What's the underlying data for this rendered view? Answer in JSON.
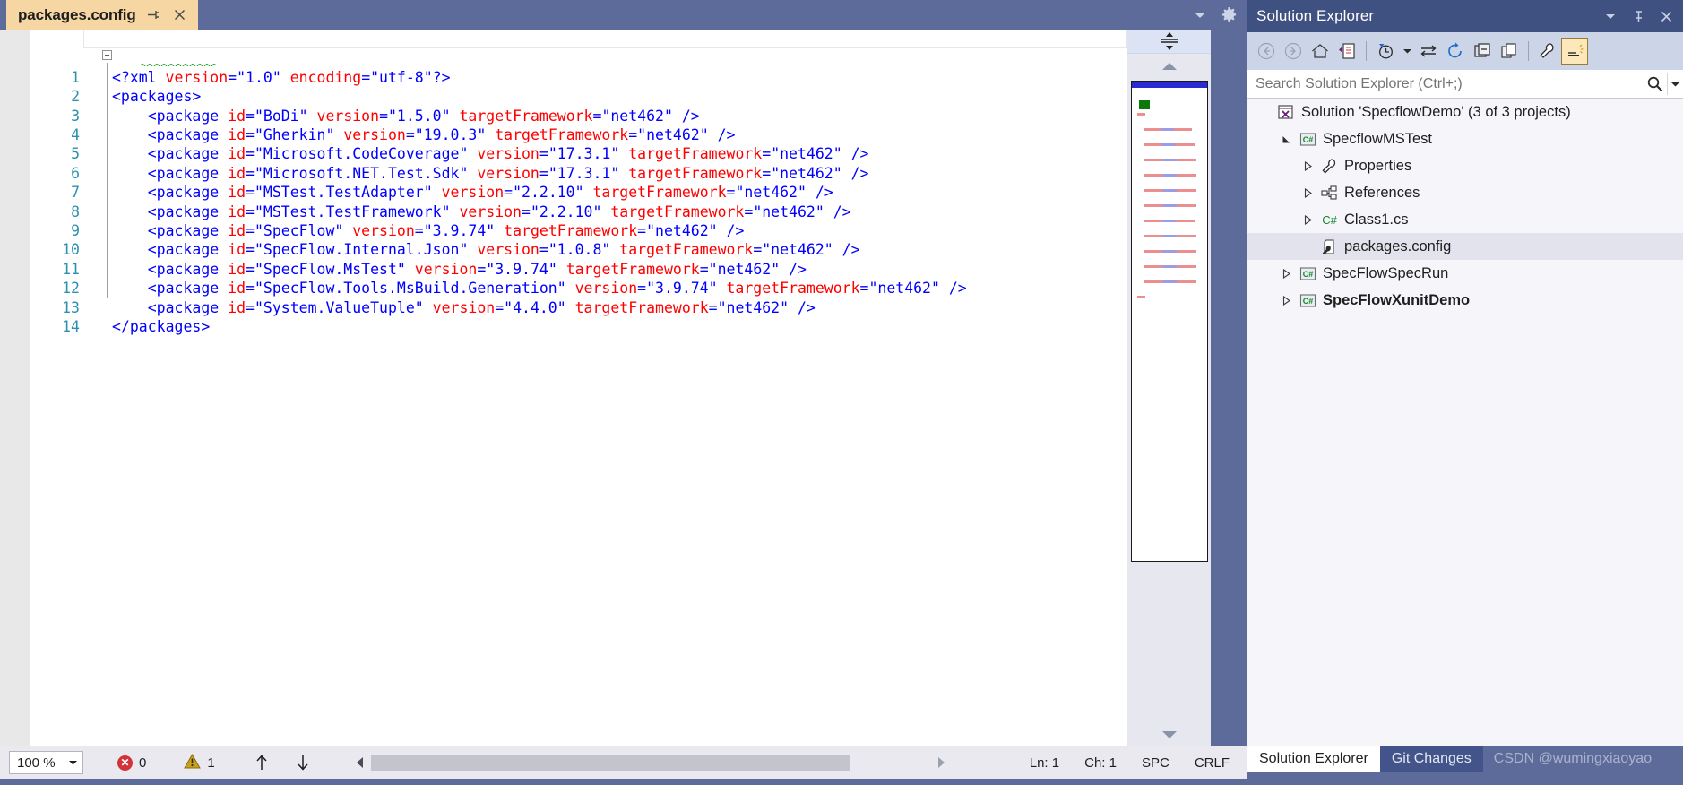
{
  "window": {
    "theme_accent": "#5d6b9b",
    "tab_active_bg": "#f6d6a2"
  },
  "editor": {
    "tab": {
      "title": "packages.config",
      "pin_icon": "pin-icon",
      "close_icon": "close-icon"
    },
    "tabstrip": {
      "dropdown_icon": "chevron-down-icon",
      "settings_icon": "gear-icon"
    },
    "gutter": {
      "fold_marker": "collapse-minus-icon"
    },
    "lines": [
      {
        "num": "1",
        "indent": 0,
        "tokens": [
          {
            "t": "<?xml ",
            "c": "xtag"
          },
          {
            "t": "version",
            "c": "xattr"
          },
          {
            "t": "=",
            "c": "xpunc"
          },
          {
            "t": "\"1.0\"",
            "c": "xval"
          },
          {
            "t": " ",
            "c": "xtag"
          },
          {
            "t": "encoding",
            "c": "xattr"
          },
          {
            "t": "=",
            "c": "xpunc"
          },
          {
            "t": "\"utf-8\"",
            "c": "xval"
          },
          {
            "t": "?>",
            "c": "xtag"
          }
        ]
      },
      {
        "num": "2",
        "indent": 0,
        "tokens": [
          {
            "t": "<packages>",
            "c": "xtag"
          }
        ]
      },
      {
        "num": "3",
        "indent": 2,
        "tokens": [
          {
            "t": "<package ",
            "c": "xtag"
          },
          {
            "t": "id",
            "c": "xattr"
          },
          {
            "t": "=",
            "c": "xpunc"
          },
          {
            "t": "\"BoDi\"",
            "c": "xval"
          },
          {
            "t": " ",
            "c": "xtag"
          },
          {
            "t": "version",
            "c": "xattr"
          },
          {
            "t": "=",
            "c": "xpunc"
          },
          {
            "t": "\"1.5.0\"",
            "c": "xval"
          },
          {
            "t": " ",
            "c": "xtag"
          },
          {
            "t": "targetFramework",
            "c": "xattr"
          },
          {
            "t": "=",
            "c": "xpunc"
          },
          {
            "t": "\"net462\"",
            "c": "xval"
          },
          {
            "t": " />",
            "c": "xtag"
          }
        ]
      },
      {
        "num": "4",
        "indent": 2,
        "tokens": [
          {
            "t": "<package ",
            "c": "xtag"
          },
          {
            "t": "id",
            "c": "xattr"
          },
          {
            "t": "=",
            "c": "xpunc"
          },
          {
            "t": "\"Gherkin\"",
            "c": "xval"
          },
          {
            "t": " ",
            "c": "xtag"
          },
          {
            "t": "version",
            "c": "xattr"
          },
          {
            "t": "=",
            "c": "xpunc"
          },
          {
            "t": "\"19.0.3\"",
            "c": "xval"
          },
          {
            "t": " ",
            "c": "xtag"
          },
          {
            "t": "targetFramework",
            "c": "xattr"
          },
          {
            "t": "=",
            "c": "xpunc"
          },
          {
            "t": "\"net462\"",
            "c": "xval"
          },
          {
            "t": " />",
            "c": "xtag"
          }
        ]
      },
      {
        "num": "5",
        "indent": 2,
        "tokens": [
          {
            "t": "<package ",
            "c": "xtag"
          },
          {
            "t": "id",
            "c": "xattr"
          },
          {
            "t": "=",
            "c": "xpunc"
          },
          {
            "t": "\"Microsoft.CodeCoverage\"",
            "c": "xval"
          },
          {
            "t": " ",
            "c": "xtag"
          },
          {
            "t": "version",
            "c": "xattr"
          },
          {
            "t": "=",
            "c": "xpunc"
          },
          {
            "t": "\"17.3.1\"",
            "c": "xval"
          },
          {
            "t": " ",
            "c": "xtag"
          },
          {
            "t": "targetFramework",
            "c": "xattr"
          },
          {
            "t": "=",
            "c": "xpunc"
          },
          {
            "t": "\"net462\"",
            "c": "xval"
          },
          {
            "t": " />",
            "c": "xtag"
          }
        ]
      },
      {
        "num": "6",
        "indent": 2,
        "tokens": [
          {
            "t": "<package ",
            "c": "xtag"
          },
          {
            "t": "id",
            "c": "xattr"
          },
          {
            "t": "=",
            "c": "xpunc"
          },
          {
            "t": "\"Microsoft.NET.Test.Sdk\"",
            "c": "xval"
          },
          {
            "t": " ",
            "c": "xtag"
          },
          {
            "t": "version",
            "c": "xattr"
          },
          {
            "t": "=",
            "c": "xpunc"
          },
          {
            "t": "\"17.3.1\"",
            "c": "xval"
          },
          {
            "t": " ",
            "c": "xtag"
          },
          {
            "t": "targetFramework",
            "c": "xattr"
          },
          {
            "t": "=",
            "c": "xpunc"
          },
          {
            "t": "\"net462\"",
            "c": "xval"
          },
          {
            "t": " />",
            "c": "xtag"
          }
        ]
      },
      {
        "num": "7",
        "indent": 2,
        "tokens": [
          {
            "t": "<package ",
            "c": "xtag"
          },
          {
            "t": "id",
            "c": "xattr"
          },
          {
            "t": "=",
            "c": "xpunc"
          },
          {
            "t": "\"MSTest.TestAdapter\"",
            "c": "xval"
          },
          {
            "t": " ",
            "c": "xtag"
          },
          {
            "t": "version",
            "c": "xattr"
          },
          {
            "t": "=",
            "c": "xpunc"
          },
          {
            "t": "\"2.2.10\"",
            "c": "xval"
          },
          {
            "t": " ",
            "c": "xtag"
          },
          {
            "t": "targetFramework",
            "c": "xattr"
          },
          {
            "t": "=",
            "c": "xpunc"
          },
          {
            "t": "\"net462\"",
            "c": "xval"
          },
          {
            "t": " />",
            "c": "xtag"
          }
        ]
      },
      {
        "num": "8",
        "indent": 2,
        "tokens": [
          {
            "t": "<package ",
            "c": "xtag"
          },
          {
            "t": "id",
            "c": "xattr"
          },
          {
            "t": "=",
            "c": "xpunc"
          },
          {
            "t": "\"MSTest.TestFramework\"",
            "c": "xval"
          },
          {
            "t": " ",
            "c": "xtag"
          },
          {
            "t": "version",
            "c": "xattr"
          },
          {
            "t": "=",
            "c": "xpunc"
          },
          {
            "t": "\"2.2.10\"",
            "c": "xval"
          },
          {
            "t": " ",
            "c": "xtag"
          },
          {
            "t": "targetFramework",
            "c": "xattr"
          },
          {
            "t": "=",
            "c": "xpunc"
          },
          {
            "t": "\"net462\"",
            "c": "xval"
          },
          {
            "t": " />",
            "c": "xtag"
          }
        ]
      },
      {
        "num": "9",
        "indent": 2,
        "tokens": [
          {
            "t": "<package ",
            "c": "xtag"
          },
          {
            "t": "id",
            "c": "xattr"
          },
          {
            "t": "=",
            "c": "xpunc"
          },
          {
            "t": "\"SpecFlow\"",
            "c": "xval"
          },
          {
            "t": " ",
            "c": "xtag"
          },
          {
            "t": "version",
            "c": "xattr"
          },
          {
            "t": "=",
            "c": "xpunc"
          },
          {
            "t": "\"3.9.74\"",
            "c": "xval"
          },
          {
            "t": " ",
            "c": "xtag"
          },
          {
            "t": "targetFramework",
            "c": "xattr"
          },
          {
            "t": "=",
            "c": "xpunc"
          },
          {
            "t": "\"net462\"",
            "c": "xval"
          },
          {
            "t": " />",
            "c": "xtag"
          }
        ]
      },
      {
        "num": "10",
        "indent": 2,
        "tokens": [
          {
            "t": "<package ",
            "c": "xtag"
          },
          {
            "t": "id",
            "c": "xattr"
          },
          {
            "t": "=",
            "c": "xpunc"
          },
          {
            "t": "\"SpecFlow.Internal.Json\"",
            "c": "xval"
          },
          {
            "t": " ",
            "c": "xtag"
          },
          {
            "t": "version",
            "c": "xattr"
          },
          {
            "t": "=",
            "c": "xpunc"
          },
          {
            "t": "\"1.0.8\"",
            "c": "xval"
          },
          {
            "t": " ",
            "c": "xtag"
          },
          {
            "t": "targetFramework",
            "c": "xattr"
          },
          {
            "t": "=",
            "c": "xpunc"
          },
          {
            "t": "\"net462\"",
            "c": "xval"
          },
          {
            "t": " />",
            "c": "xtag"
          }
        ]
      },
      {
        "num": "11",
        "indent": 2,
        "tokens": [
          {
            "t": "<package ",
            "c": "xtag"
          },
          {
            "t": "id",
            "c": "xattr"
          },
          {
            "t": "=",
            "c": "xpunc"
          },
          {
            "t": "\"SpecFlow.MsTest\"",
            "c": "xval"
          },
          {
            "t": " ",
            "c": "xtag"
          },
          {
            "t": "version",
            "c": "xattr"
          },
          {
            "t": "=",
            "c": "xpunc"
          },
          {
            "t": "\"3.9.74\"",
            "c": "xval"
          },
          {
            "t": " ",
            "c": "xtag"
          },
          {
            "t": "targetFramework",
            "c": "xattr"
          },
          {
            "t": "=",
            "c": "xpunc"
          },
          {
            "t": "\"net462\"",
            "c": "xval"
          },
          {
            "t": " />",
            "c": "xtag"
          }
        ]
      },
      {
        "num": "12",
        "indent": 2,
        "tokens": [
          {
            "t": "<package ",
            "c": "xtag"
          },
          {
            "t": "id",
            "c": "xattr"
          },
          {
            "t": "=",
            "c": "xpunc"
          },
          {
            "t": "\"SpecFlow.Tools.MsBuild.Generation\"",
            "c": "xval"
          },
          {
            "t": " ",
            "c": "xtag"
          },
          {
            "t": "version",
            "c": "xattr"
          },
          {
            "t": "=",
            "c": "xpunc"
          },
          {
            "t": "\"3.9.74\"",
            "c": "xval"
          },
          {
            "t": " ",
            "c": "xtag"
          },
          {
            "t": "targetFramework",
            "c": "xattr"
          },
          {
            "t": "=",
            "c": "xpunc"
          },
          {
            "t": "\"net462\"",
            "c": "xval"
          },
          {
            "t": " />",
            "c": "xtag"
          }
        ]
      },
      {
        "num": "13",
        "indent": 2,
        "tokens": [
          {
            "t": "<package ",
            "c": "xtag"
          },
          {
            "t": "id",
            "c": "xattr"
          },
          {
            "t": "=",
            "c": "xpunc"
          },
          {
            "t": "\"System.ValueTuple\"",
            "c": "xval"
          },
          {
            "t": " ",
            "c": "xtag"
          },
          {
            "t": "version",
            "c": "xattr"
          },
          {
            "t": "=",
            "c": "xpunc"
          },
          {
            "t": "\"4.4.0\"",
            "c": "xval"
          },
          {
            "t": " ",
            "c": "xtag"
          },
          {
            "t": "targetFramework",
            "c": "xattr"
          },
          {
            "t": "=",
            "c": "xpunc"
          },
          {
            "t": "\"net462\"",
            "c": "xval"
          },
          {
            "t": " />",
            "c": "xtag"
          }
        ]
      },
      {
        "num": "14",
        "indent": 0,
        "tokens": [
          {
            "t": "</packages>",
            "c": "xtag"
          }
        ]
      }
    ],
    "scroll": {
      "split_icon": "split-view-icon",
      "up_icon": "scroll-up-arrow-icon",
      "down_icon": "scroll-down-arrow-icon",
      "minimap": "code-minimap"
    }
  },
  "status_bar": {
    "zoom": "100 %",
    "zoom_caret_icon": "chevron-down-icon",
    "error_icon": "error-icon",
    "error_count": "0",
    "warning_icon": "warning-icon",
    "warning_count": "1",
    "prev_icon": "arrow-up-icon",
    "next_icon": "arrow-down-icon",
    "hscroll_left_icon": "scroll-left-arrow-icon",
    "hscroll_right_icon": "scroll-right-arrow-icon",
    "line": "Ln: 1",
    "column": "Ch: 1",
    "spaces": "SPC",
    "line_endings": "CRLF"
  },
  "solution_explorer": {
    "title": "Solution Explorer",
    "header_buttons": [
      {
        "name": "dropdown-icon",
        "label": "chevron-down-icon"
      },
      {
        "name": "pin-icon",
        "label": "pin-icon"
      },
      {
        "name": "close-icon",
        "label": "close-icon"
      }
    ],
    "toolbar": [
      {
        "name": "back-button",
        "icon": "back-arrow-icon"
      },
      {
        "name": "forward-button",
        "icon": "forward-arrow-icon"
      },
      {
        "name": "home-button",
        "icon": "home-icon"
      },
      {
        "name": "pending-changes-button",
        "icon": "vs-document-icon"
      },
      {
        "name": "history-button",
        "icon": "clock-icon"
      },
      {
        "name": "history-dropdown",
        "icon": "chevron-down-icon"
      },
      {
        "name": "sync-button",
        "icon": "sync-arrows-icon"
      },
      {
        "name": "refresh-button",
        "icon": "refresh-circle-icon"
      },
      {
        "name": "collapse-all-button",
        "icon": "collapse-all-icon"
      },
      {
        "name": "show-all-files-button",
        "icon": "show-all-files-icon"
      },
      {
        "name": "properties-button",
        "icon": "wrench-icon"
      },
      {
        "name": "preview-selected-button",
        "icon": "preview-pane-icon"
      }
    ],
    "search": {
      "placeholder": "Search Solution Explorer (Ctrl+;)",
      "value": "",
      "search_icon": "search-icon",
      "dropdown_icon": "chevron-down-icon"
    },
    "tree": [
      {
        "label": "Solution 'SpecflowDemo' (3 of 3 projects)",
        "indent": 0,
        "twisty": "none",
        "icon": "solution-icon",
        "bold": false,
        "selected": false
      },
      {
        "label": "SpecflowMSTest",
        "indent": 1,
        "twisty": "expanded",
        "icon": "csharp-project-icon",
        "bold": false,
        "selected": false
      },
      {
        "label": "Properties",
        "indent": 2,
        "twisty": "collapsed",
        "icon": "wrench-icon",
        "bold": false,
        "selected": false
      },
      {
        "label": "References",
        "indent": 2,
        "twisty": "collapsed",
        "icon": "references-icon",
        "bold": false,
        "selected": false
      },
      {
        "label": "Class1.cs",
        "indent": 2,
        "twisty": "collapsed",
        "icon": "csharp-file-icon",
        "bold": false,
        "selected": false
      },
      {
        "label": "packages.config",
        "indent": 2,
        "twisty": "none",
        "icon": "config-file-icon",
        "bold": false,
        "selected": true
      },
      {
        "label": "SpecFlowSpecRun",
        "indent": 1,
        "twisty": "collapsed",
        "icon": "csharp-project-icon",
        "bold": false,
        "selected": false
      },
      {
        "label": "SpecFlowXunitDemo",
        "indent": 1,
        "twisty": "collapsed",
        "icon": "csharp-project-icon",
        "bold": true,
        "selected": false
      }
    ],
    "bottom_tabs": [
      {
        "label": "Solution Explorer",
        "active": true
      },
      {
        "label": "Git Changes",
        "active": false
      }
    ],
    "watermark": "CSDN @wumingxiaoyao"
  }
}
